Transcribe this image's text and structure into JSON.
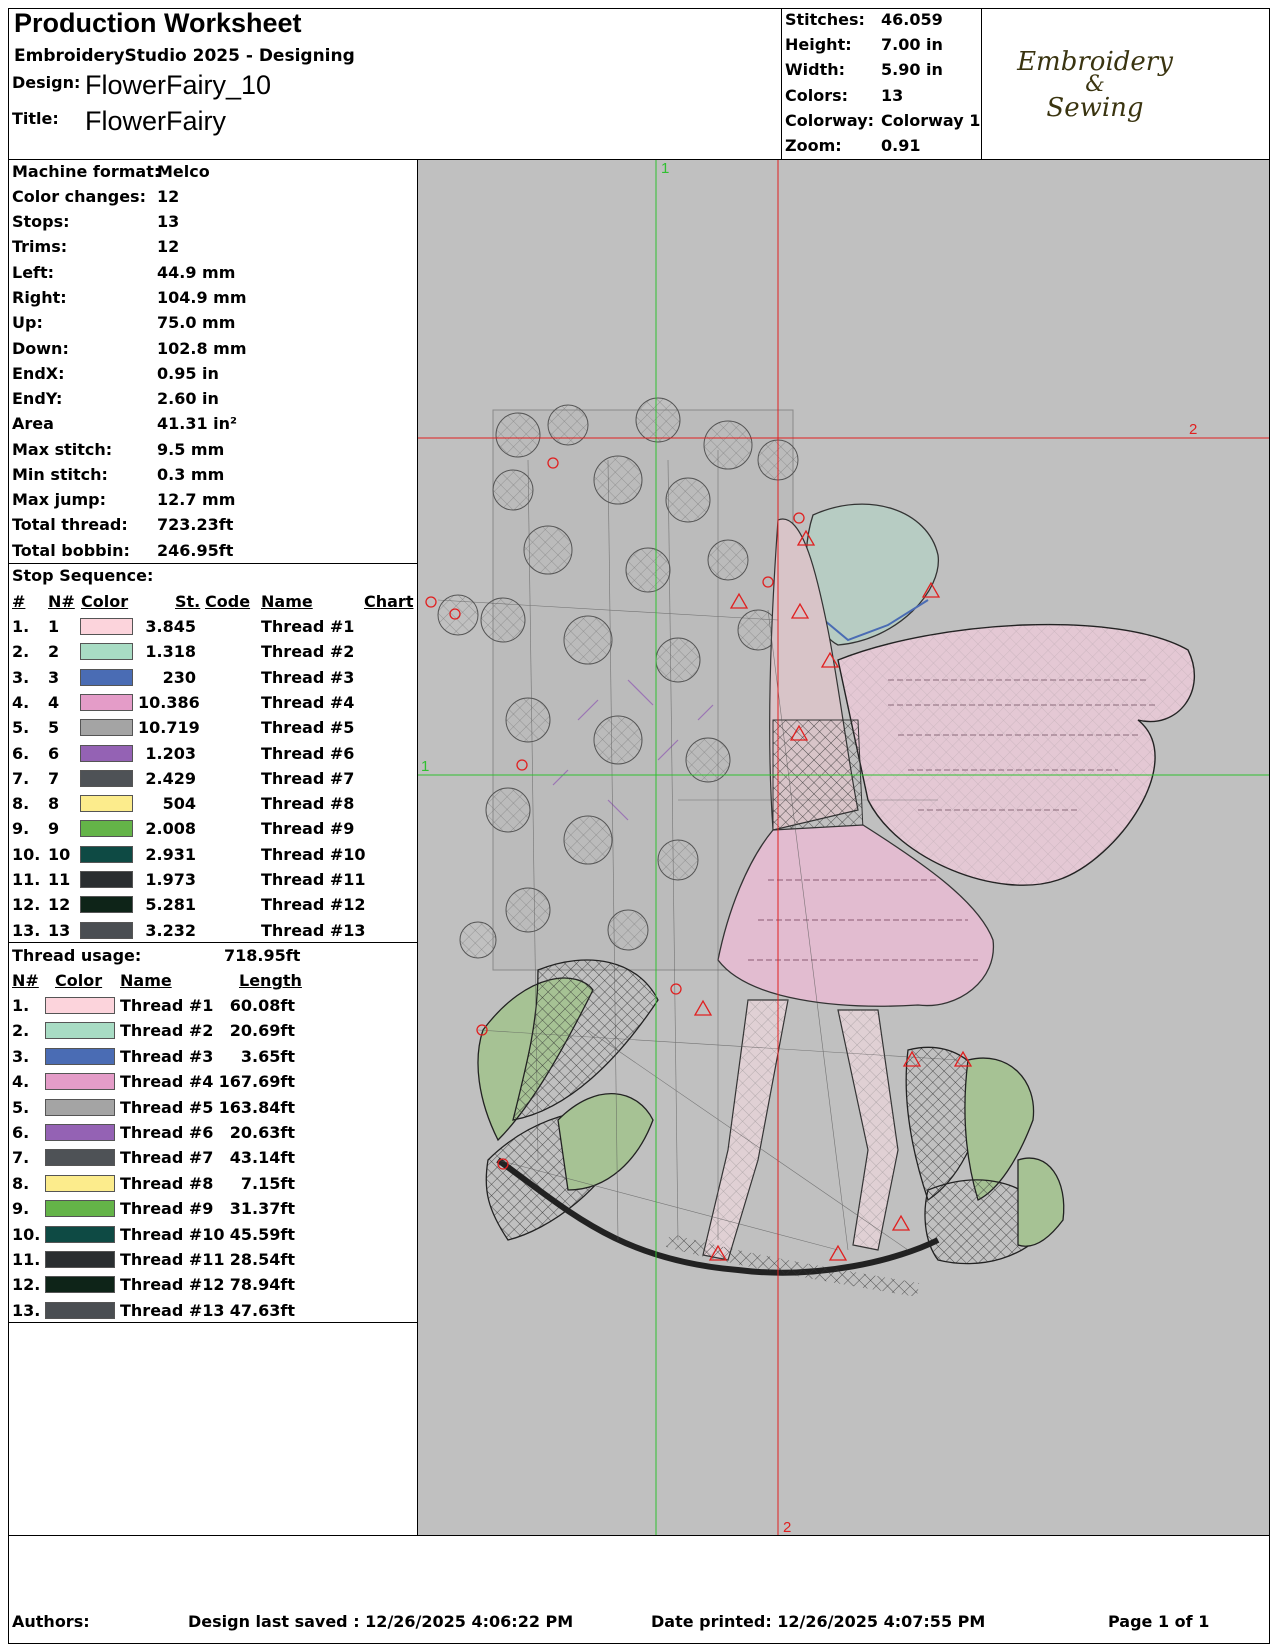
{
  "header": {
    "title": "Production Worksheet",
    "subtitle": "EmbroideryStudio 2025 - Designing",
    "design_label": "Design:",
    "design_value": "FlowerFairy_10",
    "title_label": "Title:",
    "title_value": "FlowerFairy"
  },
  "summary": [
    {
      "label": "Stitches:",
      "value": "46.059"
    },
    {
      "label": "Height:",
      "value": "7.00 in"
    },
    {
      "label": "Width:",
      "value": "5.90 in"
    },
    {
      "label": "Colors:",
      "value": "13"
    },
    {
      "label": "Colorway:",
      "value": "Colorway 1"
    },
    {
      "label": "Zoom:",
      "value": "0.91"
    }
  ],
  "logo": {
    "line1": "Embroidery",
    "line2": "&",
    "line3": "Sewing",
    "color": "#3a3410"
  },
  "machine": [
    {
      "label": "Machine format:",
      "value": "Melco"
    },
    {
      "label": "Color changes:",
      "value": "12"
    },
    {
      "label": "Stops:",
      "value": "13"
    },
    {
      "label": "Trims:",
      "value": "12"
    },
    {
      "label": "Left:",
      "value": "44.9 mm"
    },
    {
      "label": "Right:",
      "value": "104.9 mm"
    },
    {
      "label": "Up:",
      "value": "75.0 mm"
    },
    {
      "label": "Down:",
      "value": "102.8 mm"
    },
    {
      "label": "EndX:",
      "value": "0.95 in"
    },
    {
      "label": "EndY:",
      "value": "2.60 in"
    },
    {
      "label": "Area",
      "value": " 41.31 in²"
    },
    {
      "label": "Max stitch:",
      "value": "9.5 mm"
    },
    {
      "label": "Min stitch:",
      "value": "0.3 mm"
    },
    {
      "label": "Max jump:",
      "value": "12.7 mm"
    },
    {
      "label": "Total thread:",
      "value": "723.23ft"
    },
    {
      "label": "Total bobbin:",
      "value": "246.95ft"
    }
  ],
  "stop_sequence": {
    "title": "Stop Sequence:",
    "headers": {
      "num": "#",
      "n": "N#",
      "color": "Color",
      "st": "St.",
      "code": "Code",
      "name": "Name",
      "chart": "Chart"
    },
    "rows": [
      {
        "num": "1.",
        "n": "1",
        "color": "#fcd4dc",
        "st": "3.845",
        "name": "Thread #1"
      },
      {
        "num": "2.",
        "n": "2",
        "color": "#a8dcc4",
        "st": "1.318",
        "name": "Thread #2"
      },
      {
        "num": "3.",
        "n": "3",
        "color": "#4a6cb4",
        "st": "230",
        "name": "Thread #3"
      },
      {
        "num": "4.",
        "n": "4",
        "color": "#e49cc8",
        "st": "10.386",
        "name": "Thread #4"
      },
      {
        "num": "5.",
        "n": "5",
        "color": "#a4a4a4",
        "st": "10.719",
        "name": "Thread #5"
      },
      {
        "num": "6.",
        "n": "6",
        "color": "#9462b4",
        "st": "1.203",
        "name": "Thread #6"
      },
      {
        "num": "7.",
        "n": "7",
        "color": "#4e5256",
        "st": "2.429",
        "name": "Thread #7"
      },
      {
        "num": "8.",
        "n": "8",
        "color": "#fcec8c",
        "st": "504",
        "name": "Thread #8"
      },
      {
        "num": "9.",
        "n": "9",
        "color": "#64b448",
        "st": "2.008",
        "name": "Thread #9"
      },
      {
        "num": "10.",
        "n": "10",
        "color": "#0e4a44",
        "st": "2.931",
        "name": "Thread #10"
      },
      {
        "num": "11.",
        "n": "11",
        "color": "#2a2e30",
        "st": "1.973",
        "name": "Thread #11"
      },
      {
        "num": "12.",
        "n": "12",
        "color": "#0e2418",
        "st": "5.281",
        "name": "Thread #12"
      },
      {
        "num": "13.",
        "n": "13",
        "color": "#4a4e52",
        "st": "3.232",
        "name": "Thread #13"
      }
    ]
  },
  "thread_usage": {
    "title": "Thread usage:",
    "total": "718.95ft",
    "headers": {
      "n": "N#",
      "color": "Color",
      "name": "Name",
      "length": "Length"
    },
    "rows": [
      {
        "n": "1.",
        "color": "#fcd4dc",
        "name": "Thread #1",
        "length": "60.08ft"
      },
      {
        "n": "2.",
        "color": "#a8dcc4",
        "name": "Thread #2",
        "length": "20.69ft"
      },
      {
        "n": "3.",
        "color": "#4a6cb4",
        "name": "Thread #3",
        "length": "3.65ft"
      },
      {
        "n": "4.",
        "color": "#e49cc8",
        "name": "Thread #4",
        "length": "167.69ft"
      },
      {
        "n": "5.",
        "color": "#a4a4a4",
        "name": "Thread #5",
        "length": "163.84ft"
      },
      {
        "n": "6.",
        "color": "#9462b4",
        "name": "Thread #6",
        "length": "20.63ft"
      },
      {
        "n": "7.",
        "color": "#4e5256",
        "name": "Thread #7",
        "length": "43.14ft"
      },
      {
        "n": "8.",
        "color": "#fcec8c",
        "name": "Thread #8",
        "length": "7.15ft"
      },
      {
        "n": "9.",
        "color": "#64b448",
        "name": "Thread #9",
        "length": "31.37ft"
      },
      {
        "n": "10.",
        "color": "#0e4a44",
        "name": "Thread #10",
        "length": "45.59ft"
      },
      {
        "n": "11.",
        "color": "#2a2e30",
        "name": "Thread #11",
        "length": "28.54ft"
      },
      {
        "n": "12.",
        "color": "#0e2418",
        "name": "Thread #12",
        "length": "78.94ft"
      },
      {
        "n": "13.",
        "color": "#4a4e52",
        "name": "Thread #13",
        "length": "47.63ft"
      }
    ]
  },
  "preview": {
    "background": "#c0c0c0",
    "green_guide_label": "1",
    "red_guide_label": "2"
  },
  "footer": {
    "authors": "Authors:",
    "saved": "Design last saved : 12/26/2025 4:06:22 PM",
    "printed": "Date printed: 12/26/2025 4:07:55 PM",
    "page": "Page 1 of 1"
  }
}
